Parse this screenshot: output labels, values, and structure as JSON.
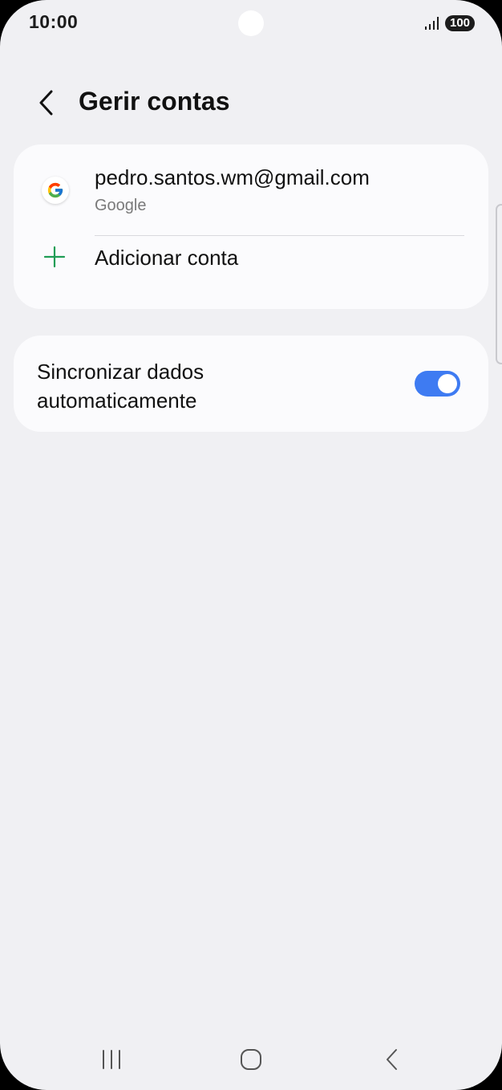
{
  "status_bar": {
    "time": "10:00",
    "battery": "100"
  },
  "header": {
    "title": "Gerir contas",
    "back_icon": "chevron-left-icon"
  },
  "accounts": {
    "items": [
      {
        "email": "pedro.santos.wm@gmail.com",
        "type": "Google",
        "icon": "google-icon"
      }
    ],
    "add_label": "Adicionar conta",
    "add_icon_color": "#1f9d55"
  },
  "sync": {
    "label": "Sincronizar dados automaticamente",
    "enabled": true,
    "toggle_color": "#3e7bf2"
  },
  "nav_bar": {
    "recents_icon": "recents-icon",
    "home_icon": "home-icon",
    "back_icon": "back-icon"
  }
}
